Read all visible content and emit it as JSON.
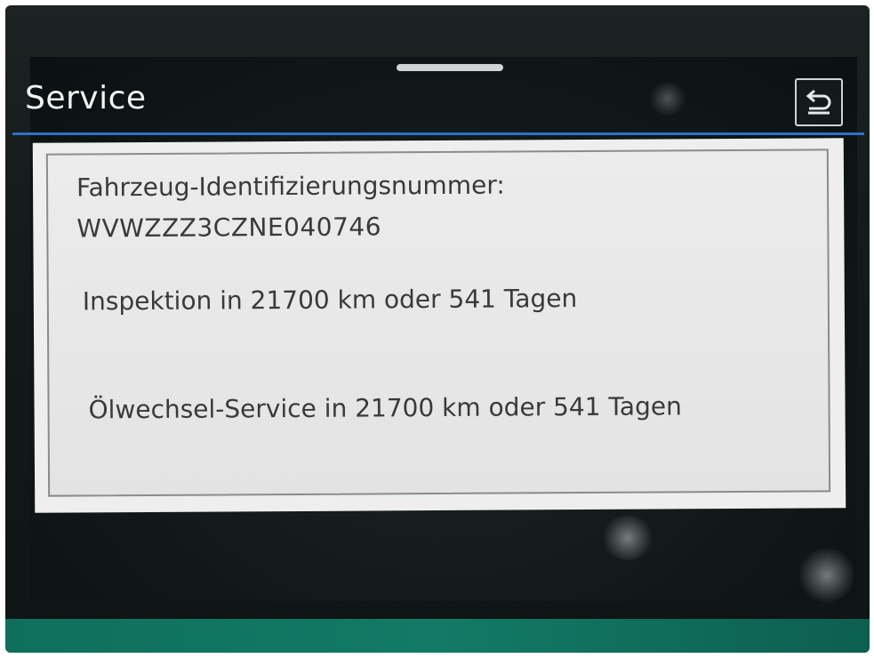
{
  "header": {
    "title": "Service",
    "back_icon": "return-arrow-icon"
  },
  "dialog": {
    "vin_label": "Fahrzeug-Identifizierungsnummer:",
    "vin_value": "WVWZZZ3CZNE040746",
    "inspection_text": "Inspektion in 21700 km oder 541 Tagen",
    "oil_service_text": "Ölwechsel-Service in 21700 km oder 541 Tagen"
  },
  "colors": {
    "accent_line": "#2a73c9",
    "dialog_background": "#eeeeee",
    "screen_background": "#101616",
    "text": "#3a3a3a"
  }
}
